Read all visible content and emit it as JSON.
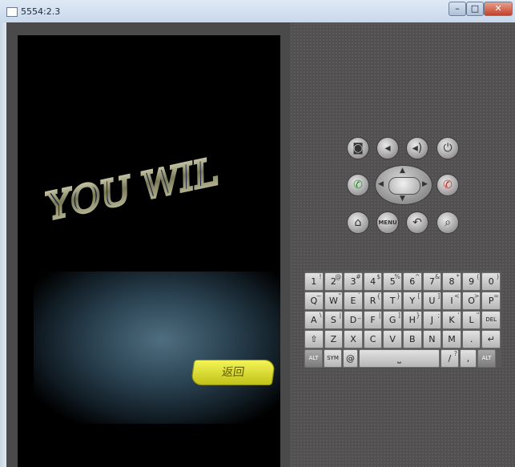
{
  "window": {
    "title": "5554:2.3",
    "min_label": "–",
    "max_label": "□",
    "close_label": "✕"
  },
  "screen": {
    "art_text": "YOU WIL",
    "back_button": "返回"
  },
  "controls": {
    "row1": [
      {
        "name": "camera-icon",
        "glyph": "◙"
      },
      {
        "name": "volume-down-icon",
        "glyph": "◂"
      },
      {
        "name": "volume-up-icon",
        "glyph": "◂)"
      },
      {
        "name": "power-icon",
        "glyph": "⏻"
      }
    ],
    "call_glyph": "✆",
    "end_call_glyph": "✆",
    "row3": [
      {
        "name": "home-icon",
        "glyph": "⌂"
      },
      {
        "name": "menu-button",
        "glyph": "MENU"
      },
      {
        "name": "back-icon",
        "glyph": "↶"
      },
      {
        "name": "search-icon",
        "glyph": "⌕"
      }
    ],
    "dpad": {
      "up": "▲",
      "down": "▼",
      "left": "◀",
      "right": "▶"
    }
  },
  "keyboard": {
    "row1": [
      [
        "1",
        "!"
      ],
      [
        "2",
        "@"
      ],
      [
        "3",
        "#"
      ],
      [
        "4",
        "$"
      ],
      [
        "5",
        "%"
      ],
      [
        "6",
        "^"
      ],
      [
        "7",
        "&"
      ],
      [
        "8",
        "*"
      ],
      [
        "9",
        "("
      ],
      [
        "0",
        ")"
      ]
    ],
    "row2": [
      [
        "Q",
        "~"
      ],
      [
        "W",
        "\""
      ],
      [
        "E",
        "`"
      ],
      [
        "R",
        "{"
      ],
      [
        "T",
        "}"
      ],
      [
        "Y",
        "["
      ],
      [
        "U",
        "]"
      ],
      [
        "I",
        "<"
      ],
      [
        "O",
        ">"
      ],
      [
        "P",
        "="
      ]
    ],
    "row3": [
      [
        "A",
        "\\"
      ],
      [
        "S",
        "|"
      ],
      [
        "D",
        "_"
      ],
      [
        "F",
        "|"
      ],
      [
        "G",
        "]"
      ],
      [
        "H",
        "}"
      ],
      [
        "J",
        ";"
      ],
      [
        "K",
        "'"
      ],
      [
        "L",
        "\""
      ],
      [
        "DEL",
        ""
      ]
    ],
    "row4": [
      [
        "⇧",
        ""
      ],
      [
        "Z",
        ""
      ],
      [
        "X",
        ""
      ],
      [
        "C",
        ""
      ],
      [
        "V",
        ""
      ],
      [
        "B",
        ""
      ],
      [
        "N",
        ""
      ],
      [
        "M",
        ""
      ],
      [
        ".",
        ""
      ],
      [
        "↵",
        ""
      ]
    ],
    "row5": [
      [
        "ALT",
        ""
      ],
      [
        "SYM",
        ""
      ],
      [
        "@",
        ""
      ],
      [
        "⎵",
        ""
      ],
      [
        "/",
        "?"
      ],
      [
        ",",
        ""
      ],
      [
        "ALT",
        ""
      ]
    ]
  }
}
